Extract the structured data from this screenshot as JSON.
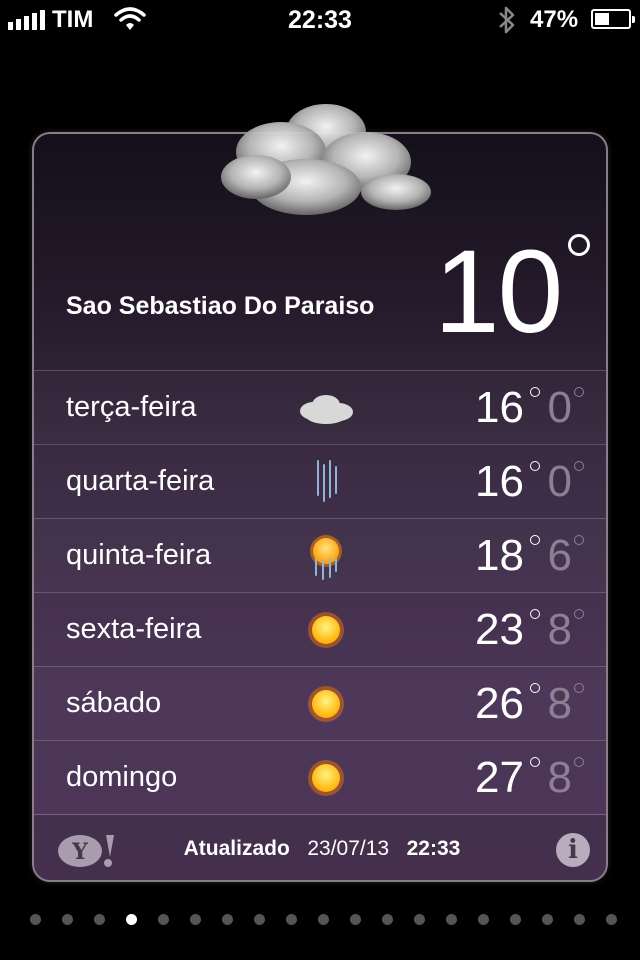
{
  "status_bar": {
    "carrier": "TIM",
    "time": "22:33",
    "battery_percent": "47%",
    "battery_level": 0.47,
    "signal_bars": 5,
    "icons": [
      "signal-icon",
      "wifi-icon",
      "bluetooth-icon",
      "battery-icon"
    ]
  },
  "weather": {
    "city": "Sao Sebastiao Do Paraiso",
    "current_temp": "10",
    "current_condition_icon": "cloud-icon",
    "forecast": [
      {
        "day": "terça-feira",
        "icon": "cloud-icon",
        "high": "16",
        "low": "0"
      },
      {
        "day": "quarta-feira",
        "icon": "rain-icon",
        "high": "16",
        "low": "0"
      },
      {
        "day": "quinta-feira",
        "icon": "sun-rain-icon",
        "high": "18",
        "low": "6"
      },
      {
        "day": "sexta-feira",
        "icon": "sun-icon",
        "high": "23",
        "low": "8"
      },
      {
        "day": "sábado",
        "icon": "sun-icon",
        "high": "26",
        "low": "8"
      },
      {
        "day": "domingo",
        "icon": "sun-icon",
        "high": "27",
        "low": "8"
      }
    ]
  },
  "footer": {
    "updated_label": "Atualizado",
    "updated_date": "23/07/13",
    "updated_time": "22:33",
    "provider_icon": "yahoo-icon",
    "info_icon": "info-icon"
  },
  "pager": {
    "total": 19,
    "active_index": 3
  },
  "colors": {
    "card_top": "#14101a",
    "card_bottom": "#4e3758",
    "low_temp": "#8e7f94",
    "sun": "#ffb400"
  }
}
